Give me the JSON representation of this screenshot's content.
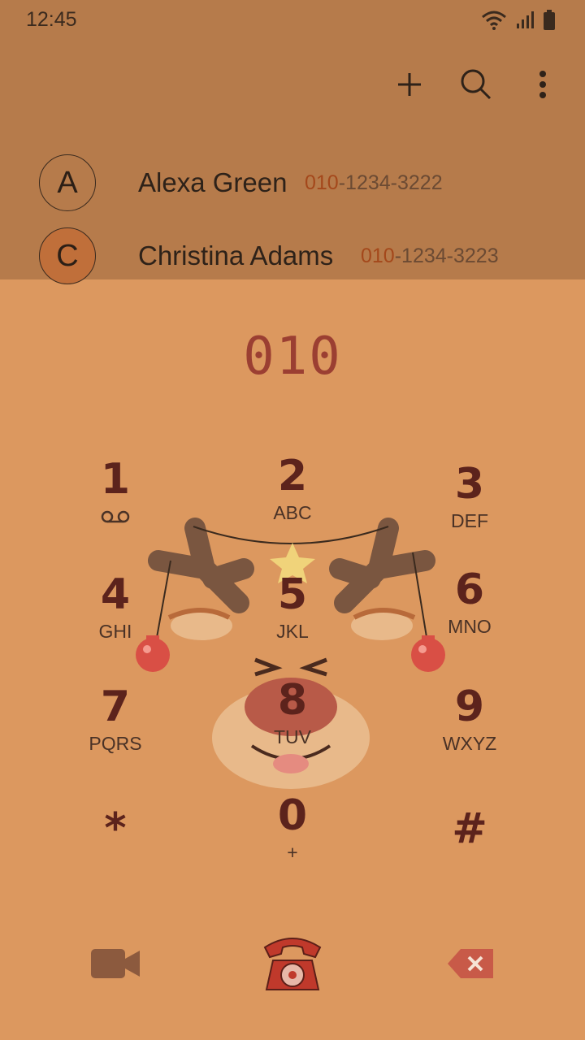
{
  "status": {
    "time": "12:45"
  },
  "toolbar": {
    "add_icon": "plus-icon",
    "search_icon": "search-icon",
    "menu_icon": "more-vertical-icon"
  },
  "contacts": [
    {
      "initial": "A",
      "name": "Alexa Green",
      "number_match": "010",
      "number_rest": "-1234-3222",
      "avatar_color": "#b67b4b"
    },
    {
      "initial": "C",
      "name": "Christina Adams",
      "number_match": "010",
      "number_rest": "-1234-3223",
      "avatar_color": "#c06f3a"
    }
  ],
  "dial": {
    "number": "010"
  },
  "keypad": [
    {
      "digit": "1",
      "letters": ""
    },
    {
      "digit": "2",
      "letters": "ABC"
    },
    {
      "digit": "3",
      "letters": "DEF"
    },
    {
      "digit": "4",
      "letters": "GHI"
    },
    {
      "digit": "5",
      "letters": "JKL"
    },
    {
      "digit": "6",
      "letters": "MNO"
    },
    {
      "digit": "7",
      "letters": "PQRS"
    },
    {
      "digit": "8",
      "letters": "TUV"
    },
    {
      "digit": "9",
      "letters": "WXYZ"
    },
    {
      "digit": "*",
      "letters": ""
    },
    {
      "digit": "0",
      "letters": "+"
    },
    {
      "digit": "#",
      "letters": ""
    }
  ],
  "colors": {
    "top_bg": "#b67b4b",
    "pad_bg": "#dc985f",
    "digit": "#5c231c",
    "accent": "#9b3f32"
  },
  "bottom": {
    "video_icon": "video-call-icon",
    "call_icon": "telephone-call-icon",
    "backspace_icon": "backspace-icon"
  }
}
